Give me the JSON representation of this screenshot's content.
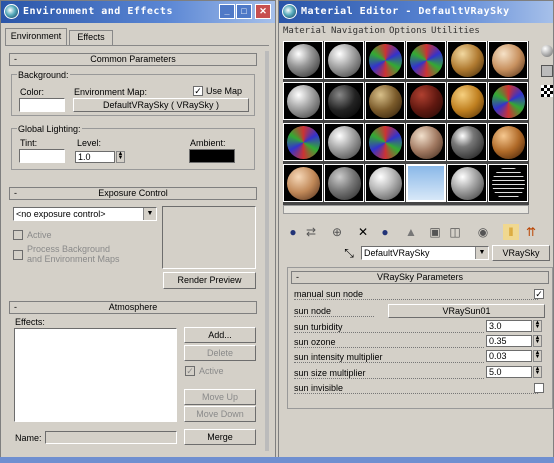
{
  "env_window": {
    "title": "Environment and Effects",
    "tabs": [
      "Environment",
      "Effects"
    ],
    "common_params": {
      "header": "Common Parameters",
      "background_group": "Background:",
      "color_label": "Color:",
      "color_value": "#ffffff",
      "env_map_label": "Environment Map:",
      "use_map_label": "Use Map",
      "use_map_checked": "✓",
      "env_map_button": "DefaultVRaySky  ( VRaySky )",
      "global_lighting_group": "Global Lighting:",
      "tint_label": "Tint:",
      "tint_value": "#ffffff",
      "level_label": "Level:",
      "level_value": "1.0",
      "ambient_label": "Ambient:",
      "ambient_value": "#000000"
    },
    "exposure": {
      "header": "Exposure Control",
      "dropdown_value": "<no exposure control>",
      "active_label": "Active",
      "process_bg_label": "Process Background\nand Environment Maps",
      "render_preview": "Render Preview"
    },
    "atmosphere": {
      "header": "Atmosphere",
      "effects_label": "Effects:",
      "add": "Add...",
      "delete": "Delete",
      "active_label": "Active",
      "active_checked": "✓",
      "move_up": "Move Up",
      "move_down": "Move Down",
      "name_label": "Name:",
      "merge": "Merge"
    }
  },
  "mat_window": {
    "title": "Material Editor - DefaultVRaySky",
    "menu": [
      "Material",
      "Navigation",
      "Options",
      "Utilities"
    ],
    "material_name": "DefaultVRaySky",
    "material_type": "VRaySky",
    "rollout_header": "VRaySky Parameters",
    "params": [
      {
        "label": "manual sun node",
        "kind": "check",
        "value": "✓"
      },
      {
        "label": "sun node",
        "kind": "button",
        "value": "VRaySun01"
      },
      {
        "label": "sun turbidity",
        "kind": "spin",
        "value": "3.0"
      },
      {
        "label": "sun ozone",
        "kind": "spin",
        "value": "0.35"
      },
      {
        "label": "sun intensity multiplier",
        "kind": "spin",
        "value": "0.03"
      },
      {
        "label": "sun size multiplier",
        "kind": "spin",
        "value": "5.0"
      },
      {
        "label": "sun invisible",
        "kind": "check",
        "value": ""
      }
    ]
  }
}
